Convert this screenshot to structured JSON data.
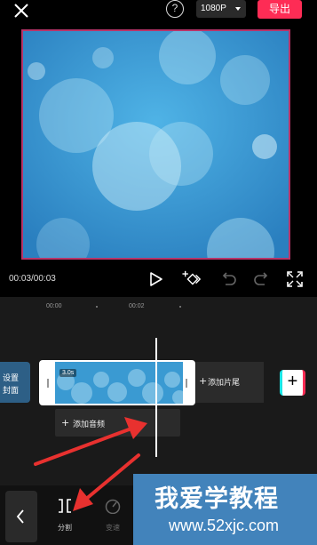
{
  "topbar": {
    "close_icon": "close-icon",
    "help_label": "?",
    "resolution": "1080P",
    "export_label": "导出"
  },
  "preview": {
    "description_icon": "bokeh-blue-image"
  },
  "controls": {
    "time": "00:03/00:03",
    "icons": [
      "play-icon",
      "keyframe-add-icon",
      "undo-icon",
      "redo-icon",
      "fullscreen-icon"
    ]
  },
  "timeline": {
    "ruler": [
      "00:00",
      "00:02"
    ],
    "cover": {
      "line1": "设置",
      "line2": "封面"
    },
    "clip": {
      "duration": "3.0s"
    },
    "add_tail": {
      "plus": "+",
      "label": "添加片尾"
    },
    "add_button": "+",
    "add_audio": {
      "plus": "+",
      "label": "添加音频"
    }
  },
  "toolbar": {
    "back_icon": "chevron-left-icon",
    "tools": [
      {
        "icon": "split-icon",
        "label": "分割"
      },
      {
        "icon": "speed-icon",
        "label": "变速"
      }
    ]
  },
  "watermark": {
    "line1": "我爱学教程",
    "line2": "www.52xjc.com"
  },
  "colors": {
    "accent": "#fe2c55",
    "preview_border": "#b83468",
    "sky": "#3b9bd4",
    "arrow": "#e8312f"
  }
}
